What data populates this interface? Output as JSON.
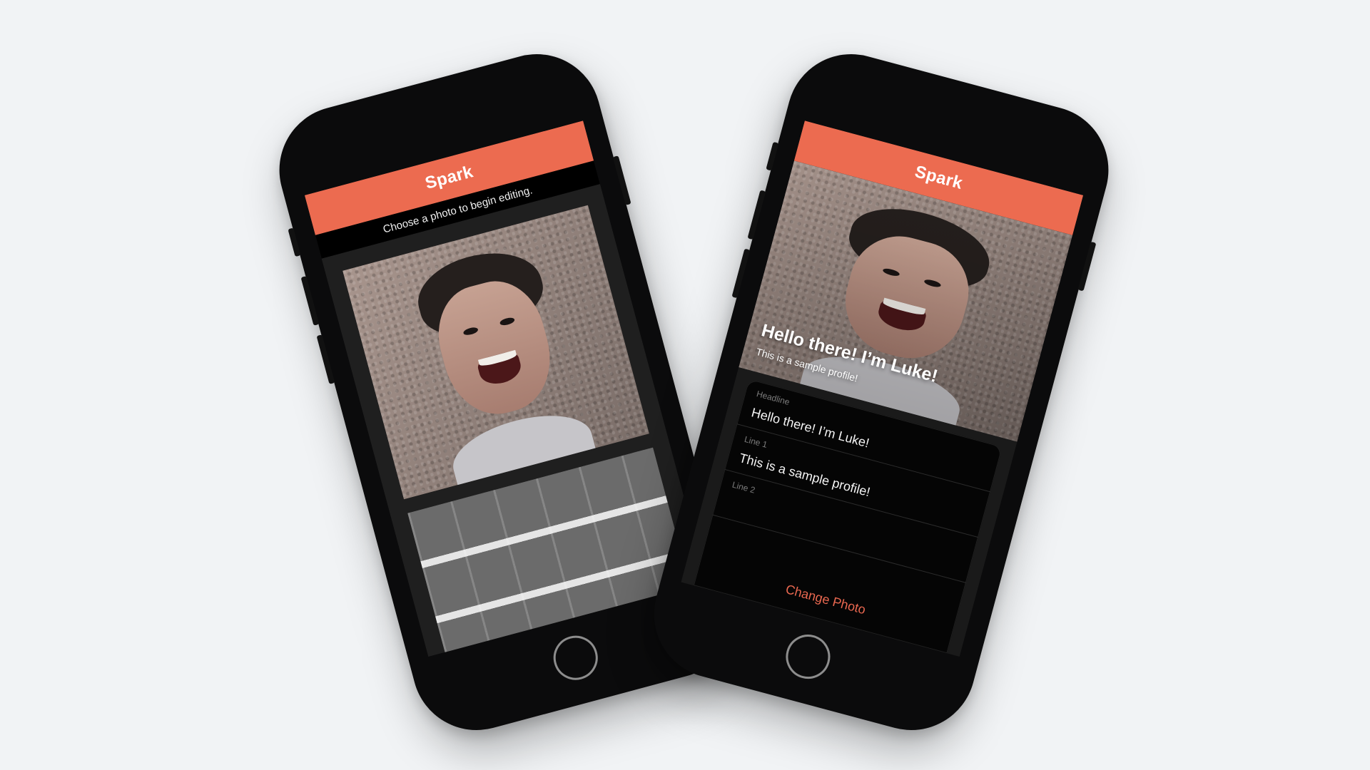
{
  "brand": {
    "title": "Spark",
    "accent": "#ec6b50"
  },
  "left_phone": {
    "prompt": "Choose a photo to begin editing."
  },
  "right_phone": {
    "hero": {
      "headline": "Hello there! I’m Luke!",
      "subline": "This is a sample profile!"
    },
    "form": {
      "headline_label": "Headline",
      "headline_value": "Hello there! I’m Luke!",
      "line1_label": "Line 1",
      "line1_value": "This is a sample profile!",
      "line2_label": "Line 2",
      "line2_value": "",
      "change_photo": "Change Photo"
    }
  }
}
